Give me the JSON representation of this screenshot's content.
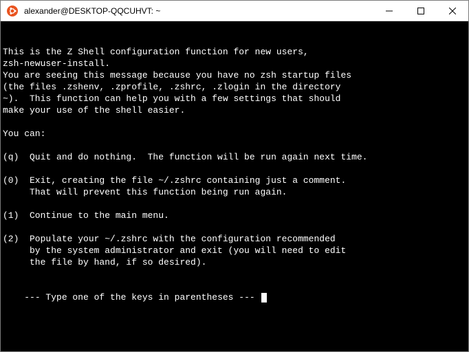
{
  "window": {
    "title": "alexander@DESKTOP-QQCUHVT: ~"
  },
  "terminal": {
    "lines": [
      "This is the Z Shell configuration function for new users,",
      "zsh-newuser-install.",
      "You are seeing this message because you have no zsh startup files",
      "(the files .zshenv, .zprofile, .zshrc, .zlogin in the directory",
      "~).  This function can help you with a few settings that should",
      "make your use of the shell easier.",
      "",
      "You can:",
      "",
      "(q)  Quit and do nothing.  The function will be run again next time.",
      "",
      "(0)  Exit, creating the file ~/.zshrc containing just a comment.",
      "     That will prevent this function being run again.",
      "",
      "(1)  Continue to the main menu.",
      "",
      "(2)  Populate your ~/.zshrc with the configuration recommended",
      "     by the system administrator and exit (you will need to edit",
      "     the file by hand, if so desired).",
      ""
    ],
    "prompt": "--- Type one of the keys in parentheses --- "
  }
}
